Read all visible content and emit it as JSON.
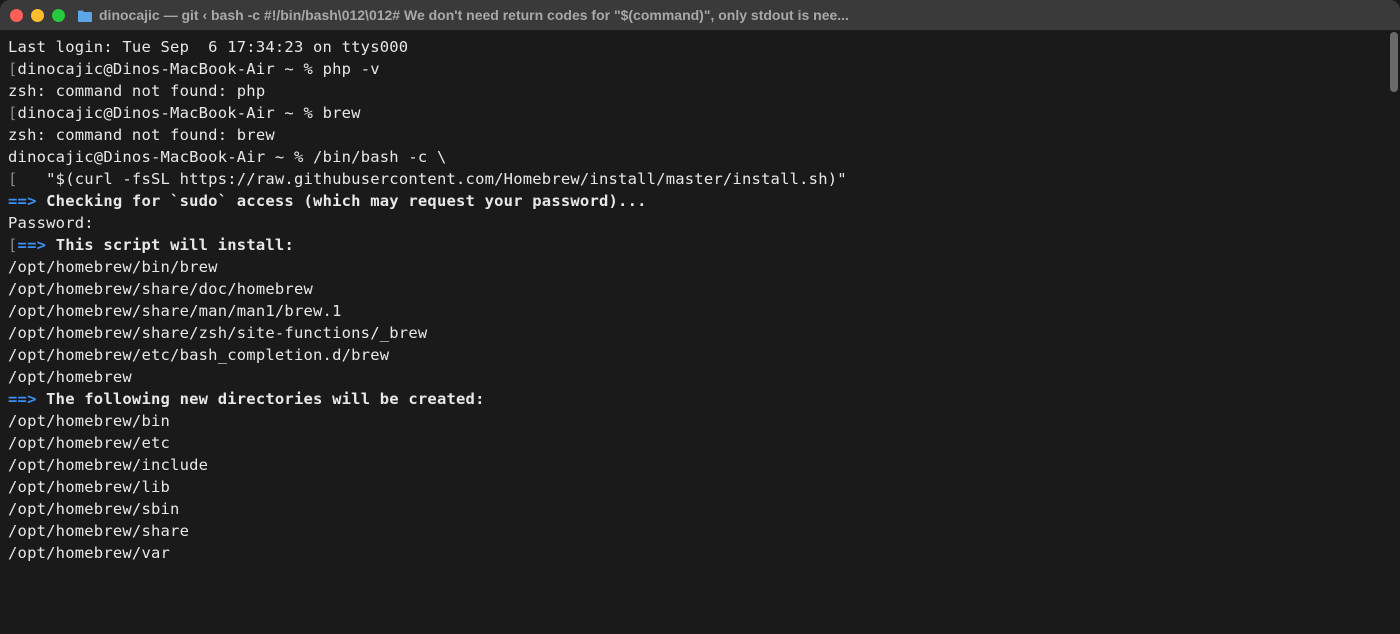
{
  "titlebar": {
    "title": "dinocajic — git ‹ bash -c #!/bin/bash\\012\\012# We don't need return codes for \"$(command)\", only stdout is nee..."
  },
  "terminal": {
    "lastLogin": "Last login: Tue Sep  6 17:34:23 on ttys000",
    "bracketOpen": "[",
    "prompt1": "dinocajic@Dinos-MacBook-Air ~ % ",
    "cmd1": "php -v",
    "err1": "zsh: command not found: php",
    "prompt2": "dinocajic@Dinos-MacBook-Air ~ % ",
    "cmd2": "brew",
    "err2": "zsh: command not found: brew",
    "prompt3": "dinocajic@Dinos-MacBook-Air ~ % ",
    "cmd3a": "/bin/bash -c \\",
    "cmd3b": "   \"$(curl -fsSL https://raw.githubusercontent.com/Homebrew/install/master/install.sh)\"",
    "arrow": "==>",
    "checkSudo": " Checking for `sudo` access (which may request your password)...",
    "password": "Password:",
    "installHeader": " This script will install:",
    "installPaths": [
      "/opt/homebrew/bin/brew",
      "/opt/homebrew/share/doc/homebrew",
      "/opt/homebrew/share/man/man1/brew.1",
      "/opt/homebrew/share/zsh/site-functions/_brew",
      "/opt/homebrew/etc/bash_completion.d/brew",
      "/opt/homebrew"
    ],
    "dirsHeader": " The following new directories will be created:",
    "dirPaths": [
      "/opt/homebrew/bin",
      "/opt/homebrew/etc",
      "/opt/homebrew/include",
      "/opt/homebrew/lib",
      "/opt/homebrew/sbin",
      "/opt/homebrew/share",
      "/opt/homebrew/var"
    ]
  }
}
